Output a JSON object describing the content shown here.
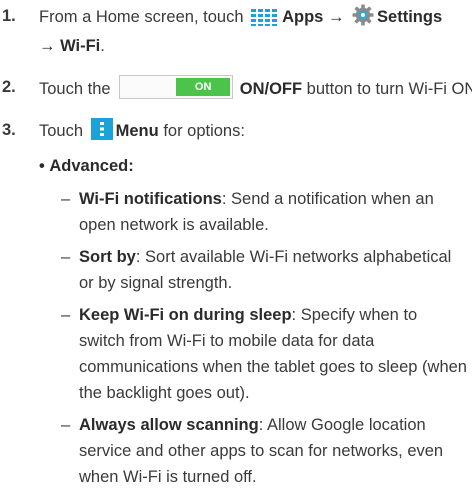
{
  "steps": [
    {
      "number": "1.",
      "pre": "From a Home screen, touch",
      "apps_icon": "apps-grid-icon",
      "apps_label": "Apps",
      "arrow": "→",
      "settings_icon": "settings-gear-icon",
      "settings_label": "Settings",
      "line2_arrow": "→",
      "wifi_label": "Wi-Fi",
      "end": "."
    },
    {
      "number": "2.",
      "pre": "Touch the",
      "toggle_text": "ON",
      "onoff_label": "ON/OFF",
      "post": "button to turn Wi-Fi ON."
    },
    {
      "number": "3.",
      "pre": "Touch",
      "menu_icon": "menu-icon",
      "menu_label": "Menu",
      "post": "for options:"
    }
  ],
  "advanced": {
    "bullet": "•",
    "label": "Advanced:",
    "items": [
      {
        "title": "Wi-Fi notifications",
        "lines": [
          "Send a notification when an",
          "open network is available."
        ]
      },
      {
        "title": "Sort by",
        "lines": [
          "Sort available Wi-Fi networks alphabetical",
          "or by signal strength."
        ]
      },
      {
        "title": "Keep Wi-Fi on during sleep",
        "lines": [
          "Specify when to",
          "switch from Wi-Fi to mobile data for data",
          "communications when the tablet goes to sleep (when",
          "the backlight goes out)."
        ]
      },
      {
        "title": "Always allow scanning",
        "lines": [
          "Allow Google location",
          "service and other apps to scan for networks, even",
          "when Wi-Fi is turned off."
        ]
      }
    ],
    "dash": "–",
    "colon": ":"
  },
  "colors": {
    "text": "#3a3a3a",
    "toggle_on": "#4cc44c",
    "menu_icon": "#1aa3d9",
    "apps_icon": "#1aa3d9"
  }
}
